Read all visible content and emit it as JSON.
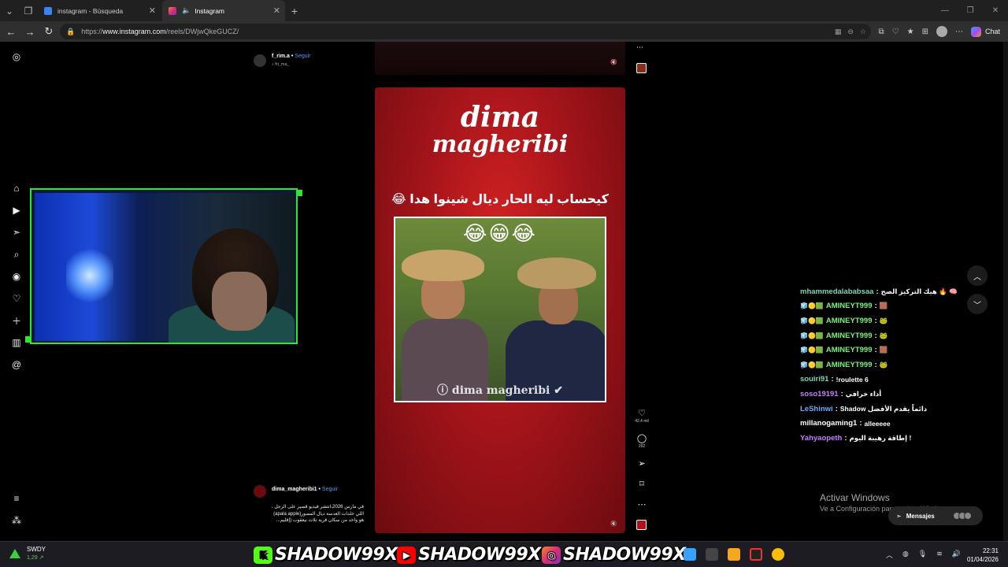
{
  "browser": {
    "tabs": [
      {
        "title": "instagram - Búsqueda",
        "active": false
      },
      {
        "title": "Instagram",
        "active": true
      }
    ],
    "url_scheme": "https://",
    "url_host": "www.instagram.com",
    "url_path": "/reels/DWjwQkeGUCZ/",
    "chat_label": "Chat"
  },
  "post_top": {
    "username": "f_rim.a",
    "follow": "Seguir",
    "sub": "fri_ma_"
  },
  "reel": {
    "logo_line1": "dima",
    "logo_line2": "magheribi",
    "caption": "كيحساب ليه الحار ديال شينوا هدا 😂",
    "emojis": "😂😁😂",
    "watermark": "ⓘ dima magheribi ✔",
    "likes": "42,4 mil",
    "comments": "292"
  },
  "post_bottom": {
    "username": "dima_magheribi1",
    "follow": "Seguir",
    "desc_line1": "في مارس 2026،انتشر فيديو قصير على الرجل ،",
    "desc_line2": "اللي خلدات العدسة ديال المصور(apala apple)",
    "desc_line3": "هو واحد من سكان قرية تلات نيعقوب (إقليم..."
  },
  "chat": {
    "messages": [
      {
        "badges": "",
        "user": "mhammedalababsaa",
        "user_color": "#7fd6b5",
        "text": "هيك التركيز الصح 🔥 🧠"
      },
      {
        "badges": "🧊🟡🟩",
        "user": "AMINEYT999",
        "user_color": "#7cf07c",
        "text": "🟫"
      },
      {
        "badges": "🧊🟡🟩",
        "user": "AMINEYT999",
        "user_color": "#7cf07c",
        "text": "🐸"
      },
      {
        "badges": "🧊🟡🟩",
        "user": "AMINEYT999",
        "user_color": "#7cf07c",
        "text": "🐸"
      },
      {
        "badges": "🧊🟡🟩",
        "user": "AMINEYT999",
        "user_color": "#7cf07c",
        "text": "🟫"
      },
      {
        "badges": "🧊🟡🟩",
        "user": "AMINEYT999",
        "user_color": "#7cf07c",
        "text": "🐸"
      },
      {
        "badges": "",
        "user": "souiri91",
        "user_color": "#7fd6b5",
        "text": "!roulette 6"
      },
      {
        "badges": "",
        "user": "soso19191",
        "user_color": "#c77dff",
        "text": "أداء خرافي"
      },
      {
        "badges": "",
        "user": "LeShinwi",
        "user_color": "#6fa8ff",
        "text": "Shadow دائماً يقدم الأفضل"
      },
      {
        "badges": "",
        "user": "millanogaming1",
        "user_color": "#ffffff",
        "text": "alleeeee"
      },
      {
        "badges": "",
        "user": "Yahyaopeth",
        "user_color": "#c77dff",
        "text": "إطاقة رهيبة اليوم !"
      }
    ]
  },
  "windows": {
    "activate_title": "Activar Windows",
    "activate_sub": "Ve a Configuración para activar Windows.",
    "messages_label": "Mensajes"
  },
  "taskbar": {
    "weather_title": "SWDY",
    "weather_sub": "1,29 ↗",
    "brand_text": "SHADOW99X",
    "time": "22:31",
    "date": "01/04/2026"
  },
  "colors": {
    "accent_green": "#2ee82e",
    "instagram_blue": "#4a9cf5",
    "reel_red": "#a3141a"
  }
}
